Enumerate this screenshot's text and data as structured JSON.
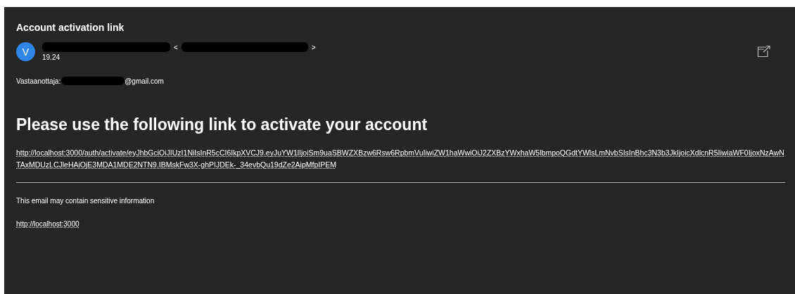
{
  "subject": "Account activation link",
  "sender": {
    "avatar_initial": "V",
    "open_bracket": "<",
    "close_bracket": ">",
    "time": "19.24"
  },
  "recipient": {
    "label": "Vastaanottaja:",
    "address_suffix": "@gmail.com"
  },
  "body": {
    "heading": "Please use the following link to activate your account",
    "link": "http://localhost:3000/auth/activate/eyJhbGciOiJIUzI1NiIsInR5cCI6IkpXVCJ9.eyJuYW1lIjoiSm9uaSBWZXBzw6Rsw6RpbmVuIiwiZW1haWwiOiJ2ZXBzYWxhaW5lbmpoQGdtYWlsLmNvbSIsInBhc3N3b3JkIjoicXdlcnR5IiwiaWF0IjoxNzAwNTAxMDUzLCJleHAiOjE3MDA1MDE2NTN9.IBMskFw3X-ghPIJDEk-_34evbQu19dZe2AipMfpIPEM"
  },
  "footer": {
    "notice": "This email may contain sensitive information",
    "link": "http://localhost:3000"
  }
}
